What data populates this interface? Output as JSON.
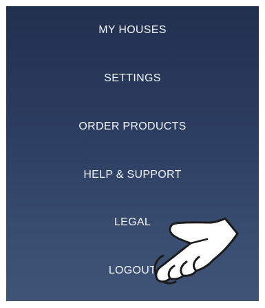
{
  "menu": {
    "items": [
      {
        "label": "MY HOUSES"
      },
      {
        "label": "SETTINGS"
      },
      {
        "label": "ORDER PRODUCTS"
      },
      {
        "label": "HELP & SUPPORT"
      },
      {
        "label": "LEGAL"
      },
      {
        "label": "LOGOUT"
      }
    ]
  },
  "overlay": {
    "icon": "tap-hand-icon"
  },
  "colors": {
    "background_top": "#22304f",
    "background_bottom": "#3f5477",
    "text": "#f2f4f8"
  }
}
